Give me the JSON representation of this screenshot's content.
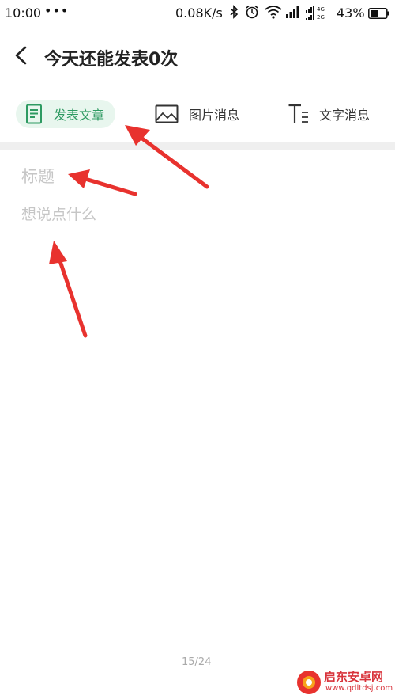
{
  "status_bar": {
    "time": "10:00",
    "dots": "•••",
    "net_speed": "0.08K/s",
    "battery_percent": "43%",
    "icons": [
      "bluetooth-icon",
      "alarm-icon",
      "wifi-icon",
      "signal-icon",
      "dual-signal-4g-2g-icon",
      "battery-icon"
    ]
  },
  "header": {
    "title": "今天还能发表0次"
  },
  "tabs": [
    {
      "label": "发表文章",
      "icon": "document-icon",
      "active": true
    },
    {
      "label": "图片消息",
      "icon": "image-icon",
      "active": false
    },
    {
      "label": "文字消息",
      "icon": "text-icon",
      "active": false
    }
  ],
  "editor": {
    "title_placeholder": "标题",
    "body_placeholder": "想说点什么",
    "counter": "15/24"
  },
  "watermark": {
    "text": "启东安卓网",
    "url": "www.qdltdsj.com"
  },
  "colors": {
    "accent": "#2e9a62",
    "accent_bg": "#e8f6ee",
    "arrow": "#e8322e",
    "placeholder": "#c6c6c6"
  }
}
